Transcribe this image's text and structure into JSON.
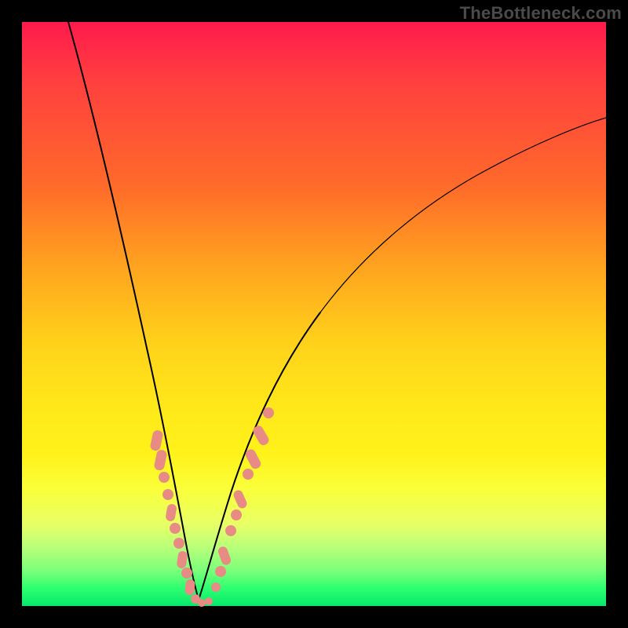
{
  "watermark": "TheBottleneck.com",
  "chart_data": {
    "type": "line",
    "title": "",
    "xlabel": "",
    "ylabel": "",
    "xlim": [
      0,
      100
    ],
    "ylim": [
      0,
      100
    ],
    "grid": false,
    "legend": false,
    "curve_left": {
      "name": "left-branch",
      "x": [
        8,
        10,
        12,
        14,
        16,
        18,
        20,
        22,
        24,
        26,
        27,
        28,
        29
      ],
      "y": [
        100,
        89,
        78,
        67,
        56,
        46,
        37,
        28,
        20,
        12,
        8,
        4,
        1
      ]
    },
    "curve_right": {
      "name": "right-branch",
      "x": [
        29,
        30,
        31,
        33,
        36,
        40,
        46,
        54,
        64,
        76,
        90,
        100
      ],
      "y": [
        1,
        3,
        7,
        14,
        24,
        35,
        47,
        58,
        67,
        74,
        80,
        84
      ]
    },
    "markers_left": {
      "note": "salmon segment along left branch near bottom",
      "x": [
        22.7,
        23.3,
        24.0,
        24.7,
        25.3,
        26.0,
        26.6,
        27.2,
        27.8,
        28.4,
        29.0,
        29.6,
        30.2
      ],
      "y": [
        28.0,
        25.5,
        23.0,
        20.6,
        18.2,
        15.8,
        13.5,
        11.2,
        9.0,
        6.8,
        4.7,
        2.8,
        1.2
      ]
    },
    "markers_right": {
      "note": "salmon segment along right branch near bottom",
      "x": [
        32.0,
        32.8,
        33.6,
        34.5,
        35.4,
        36.4,
        37.5,
        38.7,
        40.0,
        41.4
      ],
      "y": [
        11.5,
        14.0,
        16.5,
        19.2,
        22.0,
        24.8,
        27.6,
        30.5,
        33.5,
        36.5
      ]
    },
    "background_gradient": {
      "top": "#ff1a4d",
      "mid": "#ffe81a",
      "bottom": "#06e86b"
    }
  }
}
